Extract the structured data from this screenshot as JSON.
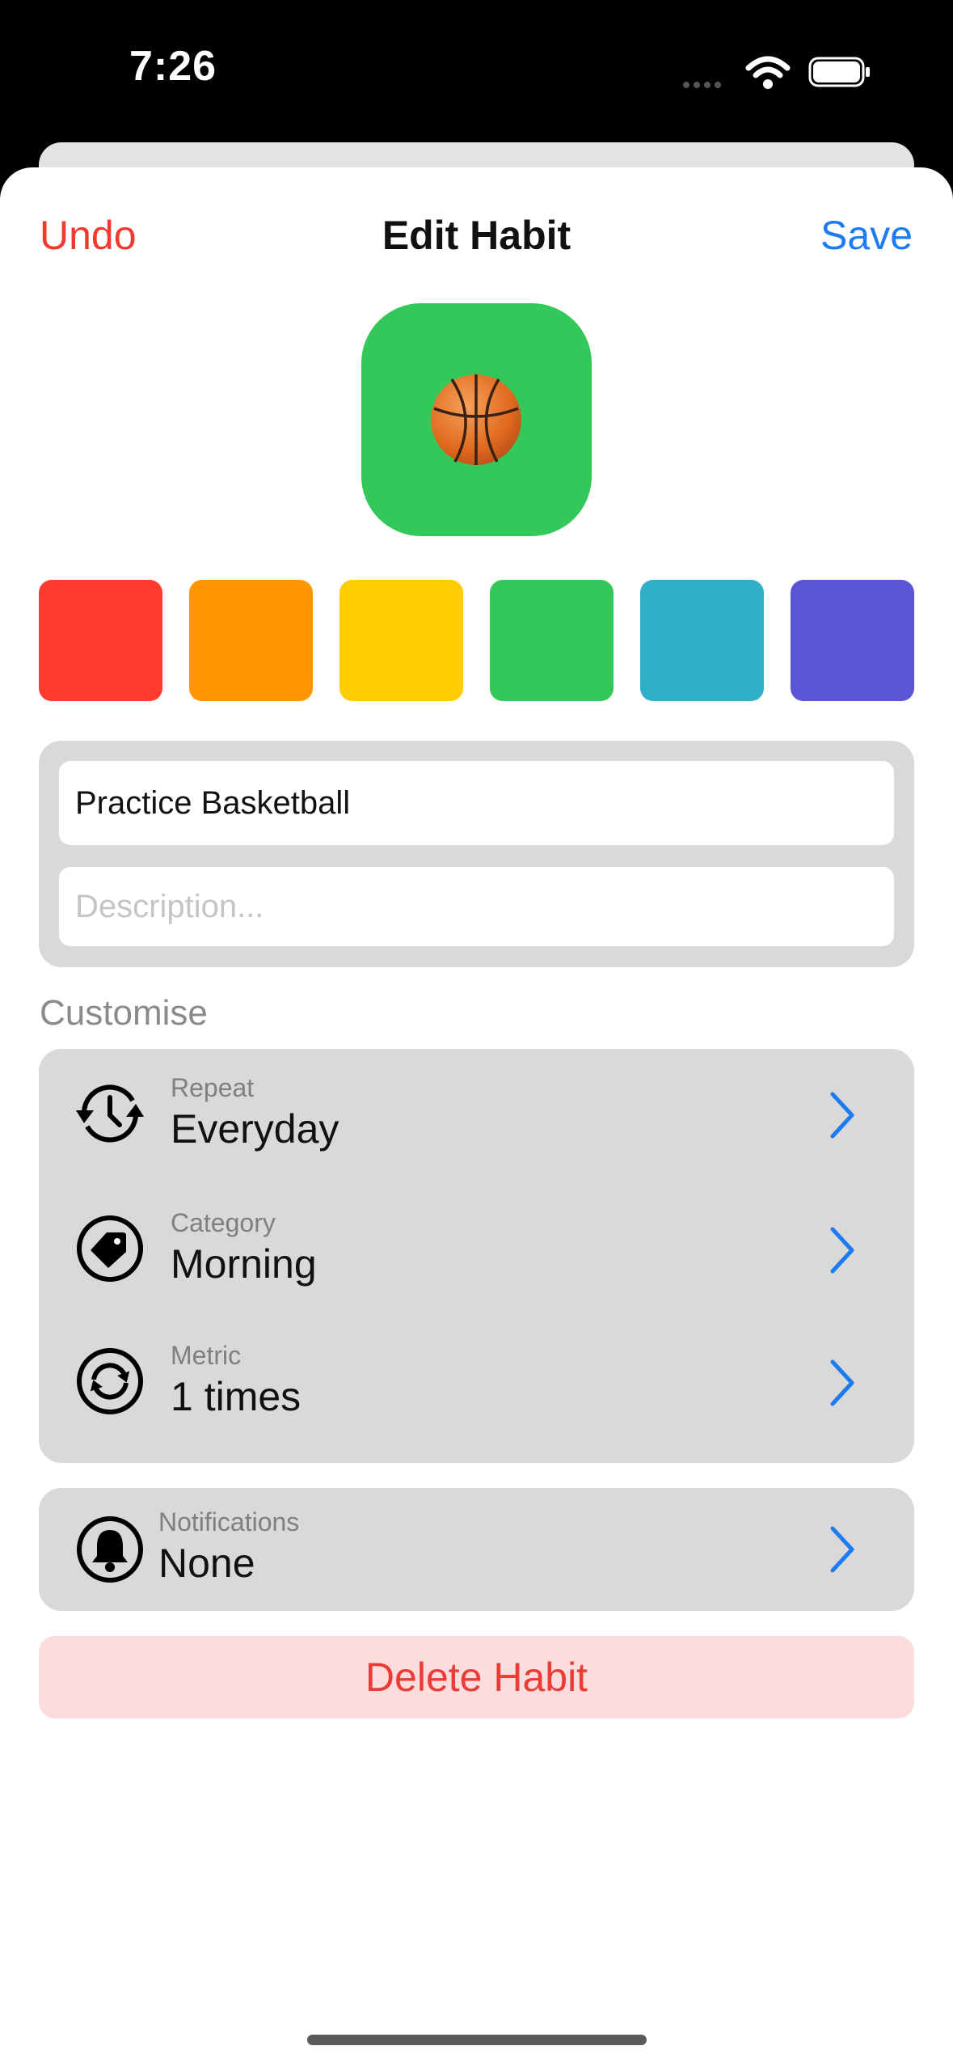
{
  "status_bar": {
    "time": "7:26"
  },
  "nav": {
    "undo_label": "Undo",
    "title": "Edit Habit",
    "save_label": "Save"
  },
  "habit_icon": {
    "emoji": "basketball",
    "color": "#34c759"
  },
  "colors": {
    "swatches": [
      {
        "name": "red",
        "hex": "#ff3b30"
      },
      {
        "name": "orange",
        "hex": "#ff9500"
      },
      {
        "name": "yellow",
        "hex": "#ffcc00"
      },
      {
        "name": "green",
        "hex": "#34c759"
      },
      {
        "name": "teal",
        "hex": "#30b0c7"
      },
      {
        "name": "indigo",
        "hex": "#5856d6"
      }
    ]
  },
  "fields": {
    "name_value": "Practice Basketball",
    "description_placeholder": "Description..."
  },
  "customise": {
    "section_label": "Customise",
    "rows": [
      {
        "caption": "Repeat",
        "value": "Everyday",
        "icon": "repeat-clock-icon"
      },
      {
        "caption": "Category",
        "value": "Morning",
        "icon": "tag-icon"
      },
      {
        "caption": "Metric",
        "value": "1 times",
        "icon": "sync-icon"
      }
    ]
  },
  "notifications": {
    "caption": "Notifications",
    "value": "None",
    "icon": "bell-icon"
  },
  "delete_label": "Delete Habit",
  "accent": {
    "blue": "#1e7cf2",
    "red": "#f03a2e"
  }
}
